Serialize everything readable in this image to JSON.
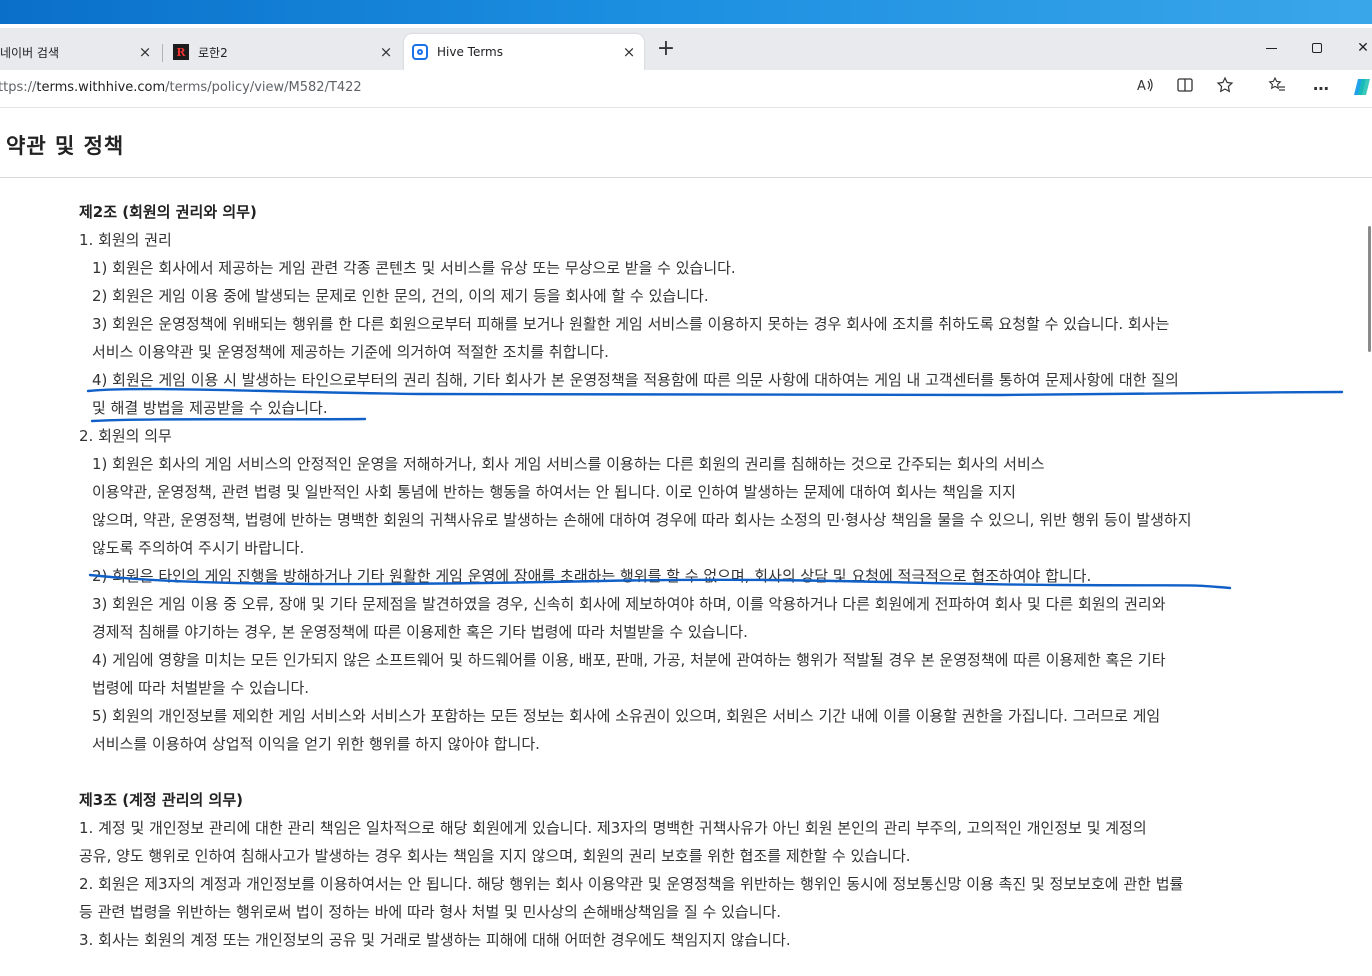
{
  "browser": {
    "tabs": [
      {
        "label": "네이버 검색",
        "close": "×"
      },
      {
        "label": "로한2",
        "close": "×"
      },
      {
        "label": "Hive Terms",
        "close": "×"
      }
    ],
    "new_tab": "+",
    "window_controls": {
      "close": "✕"
    },
    "url": {
      "scheme": "ttps://",
      "host": "terms.withhive.com",
      "path": "/terms/policy/view/M582/T422"
    },
    "icons": [
      "read-aloud-icon",
      "immersive-reader-icon",
      "favorite-star-icon",
      "favorites-icon",
      "more-icon",
      "copilot-icon"
    ],
    "accent": "#0a6fc9"
  },
  "page": {
    "title": "약관 및 정책",
    "sections": [
      {
        "heading": "제2조 (회원의 권리와 의무)",
        "lines": [
          "1. 회원의 권리",
          "1) 회원은 회사에서 제공하는 게임 관련 각종 콘텐츠 및 서비스를 유상 또는 무상으로 받을 수 있습니다.",
          "2) 회원은 게임 이용 중에 발생되는 문제로 인한 문의, 건의, 이의 제기 등을 회사에 할 수 있습니다.",
          "3) 회원은 운영정책에 위배되는 행위를 한 다른 회원으로부터 피해를 보거나 원활한 게임 서비스를 이용하지 못하는 경우 회사에 조치를 취하도록 요청할 수 있습니다. 회사는",
          "서비스 이용약관 및 운영정책에 제공하는 기준에 의거하여 적절한 조치를 취합니다.",
          "4) 회원은 게임 이용 시 발생하는 타인으로부터의 권리 침해, 기타 회사가 본 운영정책을 적용함에 따른 의문 사항에 대하여는 게임 내 고객센터를 통하여 문제사항에 대한 질의",
          "및 해결 방법을 제공받을 수 있습니다.",
          "2. 회원의 의무",
          "1) 회원은 회사의 게임 서비스의 안정적인 운영을 저해하거나, 회사 게임 서비스를 이용하는 다른 회원의 권리를 침해하는 것으로 간주되는 회사의 서비스",
          "이용약관, 운영정책, 관련 법령 및 일반적인 사회 통념에 반하는 행동을 하여서는 안 됩니다. 이로 인하여 발생하는 문제에 대하여 회사는 책임을 지지",
          "않으며, 약관, 운영정책, 법령에 반하는 명백한 회원의 귀책사유로 발생하는 손해에 대하여 경우에 따라 회사는 소정의 민·형사상 책임을 물을 수 있으니, 위반 행위 등이 발생하지",
          "않도록 주의하여 주시기 바랍니다.",
          "2) 회원은 타인의 게임 진행을 방해하거나 기타 원활한 게임 운영에 장애를 초래하는 행위를 할 수 없으며, 회사의 상담 및 요청에 적극적으로 협조하여야 합니다.",
          "3) 회원은 게임 이용 중 오류, 장애 및 기타 문제점을 발견하였을 경우, 신속히 회사에 제보하여야 하며, 이를 악용하거나 다른 회원에게 전파하여 회사 및 다른 회원의 권리와",
          "경제적 침해를 야기하는 경우, 본 운영정책에 따른 이용제한 혹은 기타 법령에 따라 처벌받을 수 있습니다.",
          "4) 게임에 영향을 미치는 모든 인가되지 않은 소프트웨어 및 하드웨어를 이용, 배포, 판매, 가공, 처분에 관여하는 행위가 적발될 경우 본 운영정책에 따른 이용제한 혹은 기타",
          "법령에 따라 처벌받을 수 있습니다.",
          "5) 회원의 개인정보를 제외한 게임 서비스와 서비스가 포함하는 모든 정보는 회사에 소유권이 있으며, 회원은 서비스 기간 내에 이를 이용할 권한을 가집니다. 그러므로 게임",
          "서비스를 이용하여 상업적 이익을 얻기 위한 행위를 하지 않아야 합니다."
        ]
      },
      {
        "heading": "제3조 (계정 관리의 의무)",
        "lines": [
          "1. 계정 및 개인정보 관리에 대한 관리 책임은 일차적으로 해당 회원에게 있습니다. 제3자의 명백한 귀책사유가 아닌 회원 본인의 관리 부주의, 고의적인 개인정보 및 계정의",
          "공유, 양도 행위로 인하여 침해사고가 발생하는 경우 회사는 책임을 지지 않으며, 회원의 권리 보호를 위한 협조를 제한할 수 있습니다.",
          "2. 회원은 제3자의 계정과 개인정보를 이용하여서는 안 됩니다. 해당 행위는 회사 이용약관 및 운영정책을 위반하는 행위인 동시에 정보통신망 이용 촉진 및 정보보호에 관한 법률",
          "등 관련 법령을 위반하는 행위로써 법이 정하는 바에 따라 형사 처벌 및 민사상의 손해배상책임을 질 수 있습니다.",
          "3. 회사는 회원의 계정 또는 개인정보의 공유 및 거래로 발생하는 피해에 대해 어떠한 경우에도 책임지지 않습니다."
        ]
      }
    ],
    "annotation_color": "#1060c8"
  }
}
